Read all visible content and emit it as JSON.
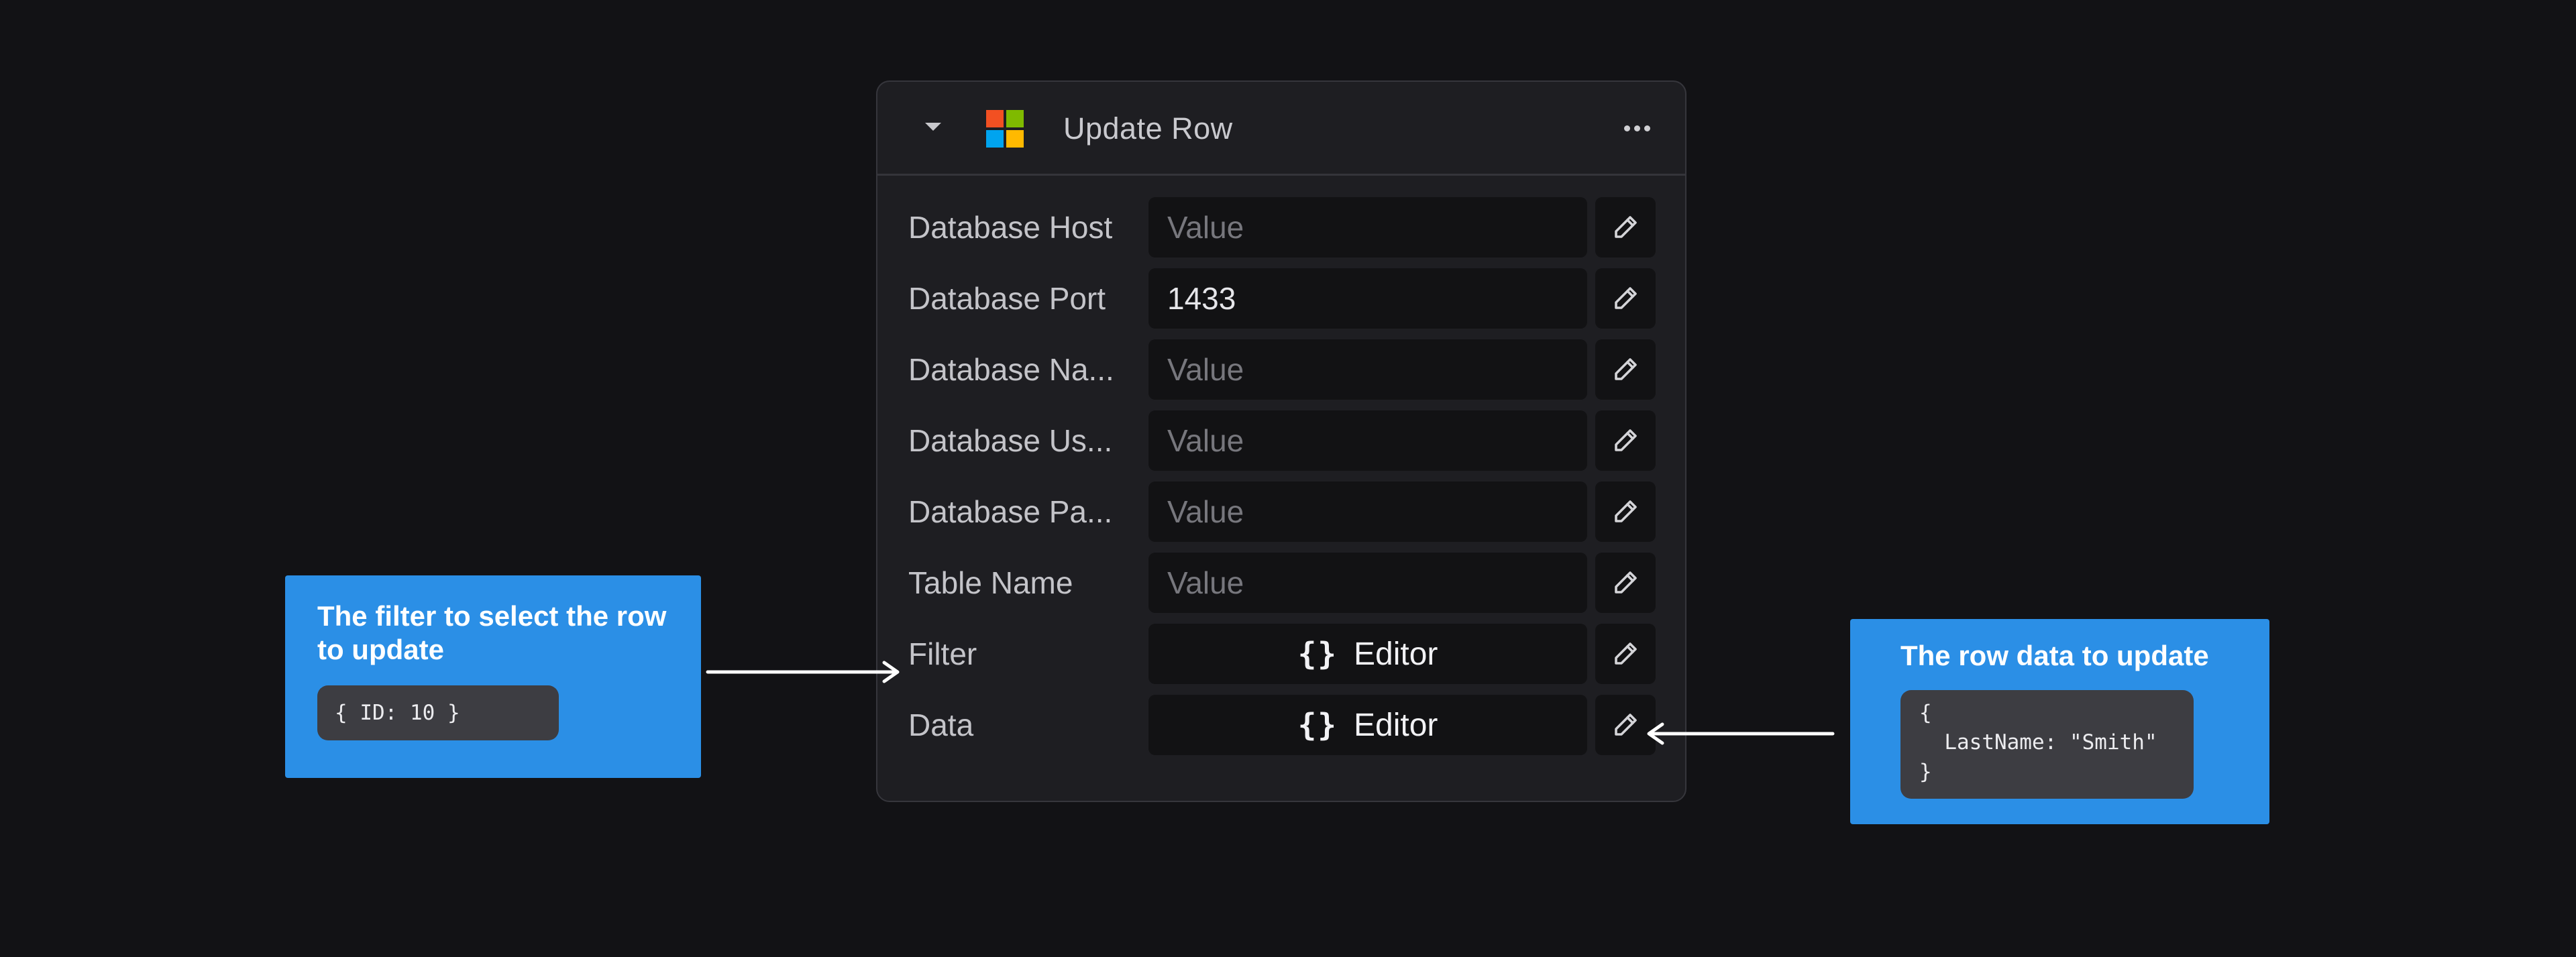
{
  "node": {
    "title": "Update Row",
    "logo_colors": [
      "#f25022",
      "#7fba00",
      "#00a4ef",
      "#ffb900"
    ],
    "collapse_icon": "caret-down-icon",
    "menu_icon": "more-horizontal-icon",
    "edit_icon": "pencil-icon",
    "fields": {
      "db_host": {
        "label": "Database Host",
        "value": "",
        "placeholder": "Value"
      },
      "db_port": {
        "label": "Database Port",
        "value": "1433",
        "placeholder": "Value"
      },
      "db_name": {
        "label": "Database Na...",
        "value": "",
        "placeholder": "Value"
      },
      "db_user": {
        "label": "Database Us...",
        "value": "",
        "placeholder": "Value"
      },
      "db_pass": {
        "label": "Database Pa...",
        "value": "",
        "placeholder": "Value"
      },
      "table_name": {
        "label": "Table Name",
        "value": "",
        "placeholder": "Value"
      },
      "filter": {
        "label": "Filter",
        "button_icon": "{}",
        "button_label": "Editor"
      },
      "data": {
        "label": "Data",
        "button_icon": "{}",
        "button_label": "Editor"
      }
    }
  },
  "callouts": {
    "filter": {
      "title": "The filter to select the row to update",
      "code": "{ ID: 10 }"
    },
    "data": {
      "title": "The row data to update",
      "code": "{\n  LastName: \"Smith\"\n}"
    }
  },
  "colors": {
    "background": "#121215",
    "node_bg": "#1e1e22",
    "input_bg": "#121214",
    "callout_bg": "#2b8fe6",
    "code_bg": "#3d3d42"
  }
}
